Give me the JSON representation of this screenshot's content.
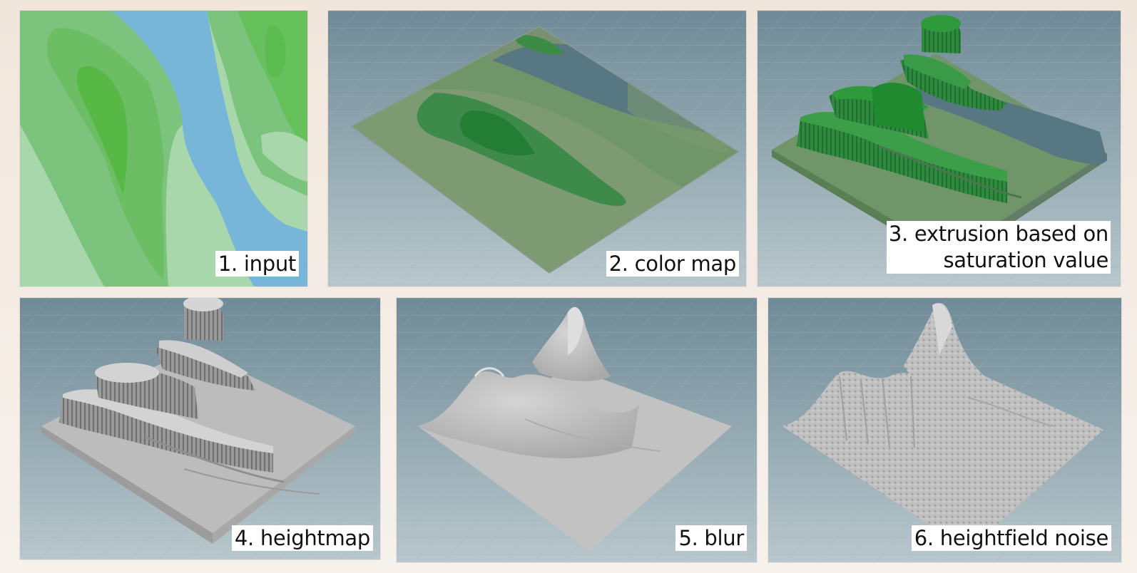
{
  "panels": [
    {
      "caption": "1. input"
    },
    {
      "caption": "2. color map"
    },
    {
      "caption_lines": [
        "3. extrusion based on",
        "saturation value"
      ]
    },
    {
      "caption": "4. heightmap"
    },
    {
      "caption": "5. blur"
    },
    {
      "caption": "6. heightfield noise"
    }
  ],
  "colors": {
    "water": "#77b5d9",
    "green_light": "#a8d7ab",
    "green_mid": "#7cc47e",
    "green_dark": "#57b845",
    "viewport_bg": "#8fa4ad",
    "clay": "#bcbcbc"
  }
}
